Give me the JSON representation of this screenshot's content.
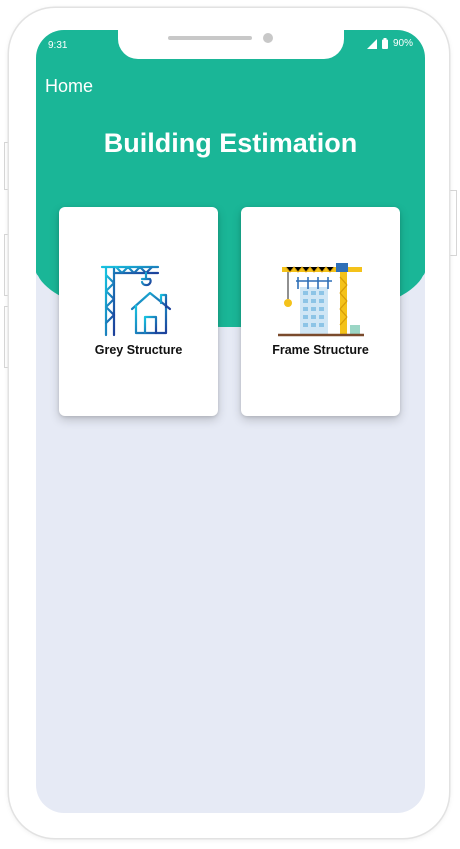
{
  "status_bar": {
    "time": "9:31",
    "battery": "90%"
  },
  "header": {
    "home_label": "Home",
    "title": "Building Estimation"
  },
  "cards": [
    {
      "label": "Grey Structure",
      "icon": "crane-house-icon"
    },
    {
      "label": "Frame Structure",
      "icon": "tower-crane-building-icon"
    }
  ],
  "colors": {
    "primary": "#1ab697",
    "background": "#e6eaf5",
    "card": "#ffffff"
  }
}
